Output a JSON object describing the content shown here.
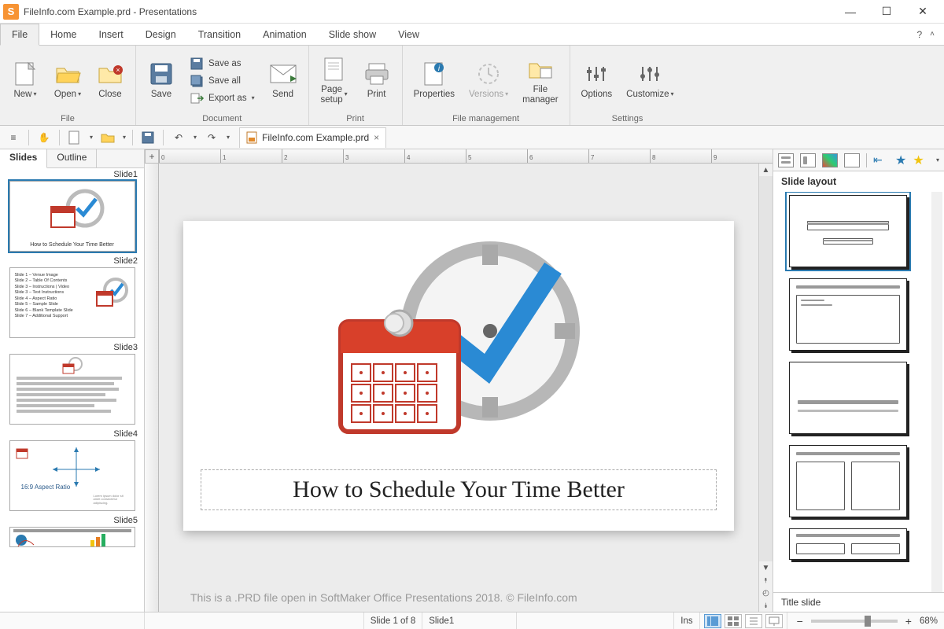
{
  "window": {
    "title": "FileInfo.com Example.prd - Presentations",
    "app_icon_letter": "S"
  },
  "menus": {
    "file": "File",
    "home": "Home",
    "insert": "Insert",
    "design": "Design",
    "transition": "Transition",
    "animation": "Animation",
    "slideshow": "Slide show",
    "view": "View"
  },
  "ribbon": {
    "groups": {
      "file": "File",
      "document": "Document",
      "print": "Print",
      "filemgmt": "File management",
      "settings": "Settings"
    },
    "new": "New",
    "open": "Open",
    "close": "Close",
    "save": "Save",
    "saveas": "Save as",
    "saveall": "Save all",
    "exportas": "Export as",
    "send": "Send",
    "pagesetup": "Page\nsetup",
    "print": "Print",
    "properties": "Properties",
    "versions": "Versions",
    "filemanager": "File\nmanager",
    "options": "Options",
    "customize": "Customize"
  },
  "doc_tab": {
    "name": "FileInfo.com Example.prd"
  },
  "side_tabs": {
    "slides": "Slides",
    "outline": "Outline"
  },
  "thumbs": {
    "s1": "Slide1",
    "s2": "Slide2",
    "s3": "Slide3",
    "s4": "Slide4",
    "s5": "Slide5",
    "s1_title": "How to Schedule Your Time Better",
    "s2_lines": [
      "Slide 1 – Venue Image",
      "Slide 2 – Table Of Contents",
      "Slide 3 – Instructions | Video",
      "Slide 3 – Text Instructions",
      "Slide 4 – Aspect Ratio",
      "Slide 5 – Sample Slide",
      "Slide 6 – Blank Template Slide",
      "Slide 7 – Additional Support"
    ],
    "s4_text": "16:9 Aspect Ratio"
  },
  "slide": {
    "title": "How to Schedule Your Time Better"
  },
  "watermark": "This is a .PRD file open in SoftMaker Office Presentations 2018. © FileInfo.com",
  "layout_panel": {
    "heading": "Slide layout",
    "footer": "Title slide"
  },
  "status": {
    "slide_count": "Slide 1 of 8",
    "slide_name": "Slide1",
    "ins": "Ins",
    "zoom": "68%"
  },
  "ruler_numbers": [
    "0",
    "1",
    "2",
    "3",
    "4",
    "5",
    "6",
    "7",
    "8",
    "9"
  ]
}
